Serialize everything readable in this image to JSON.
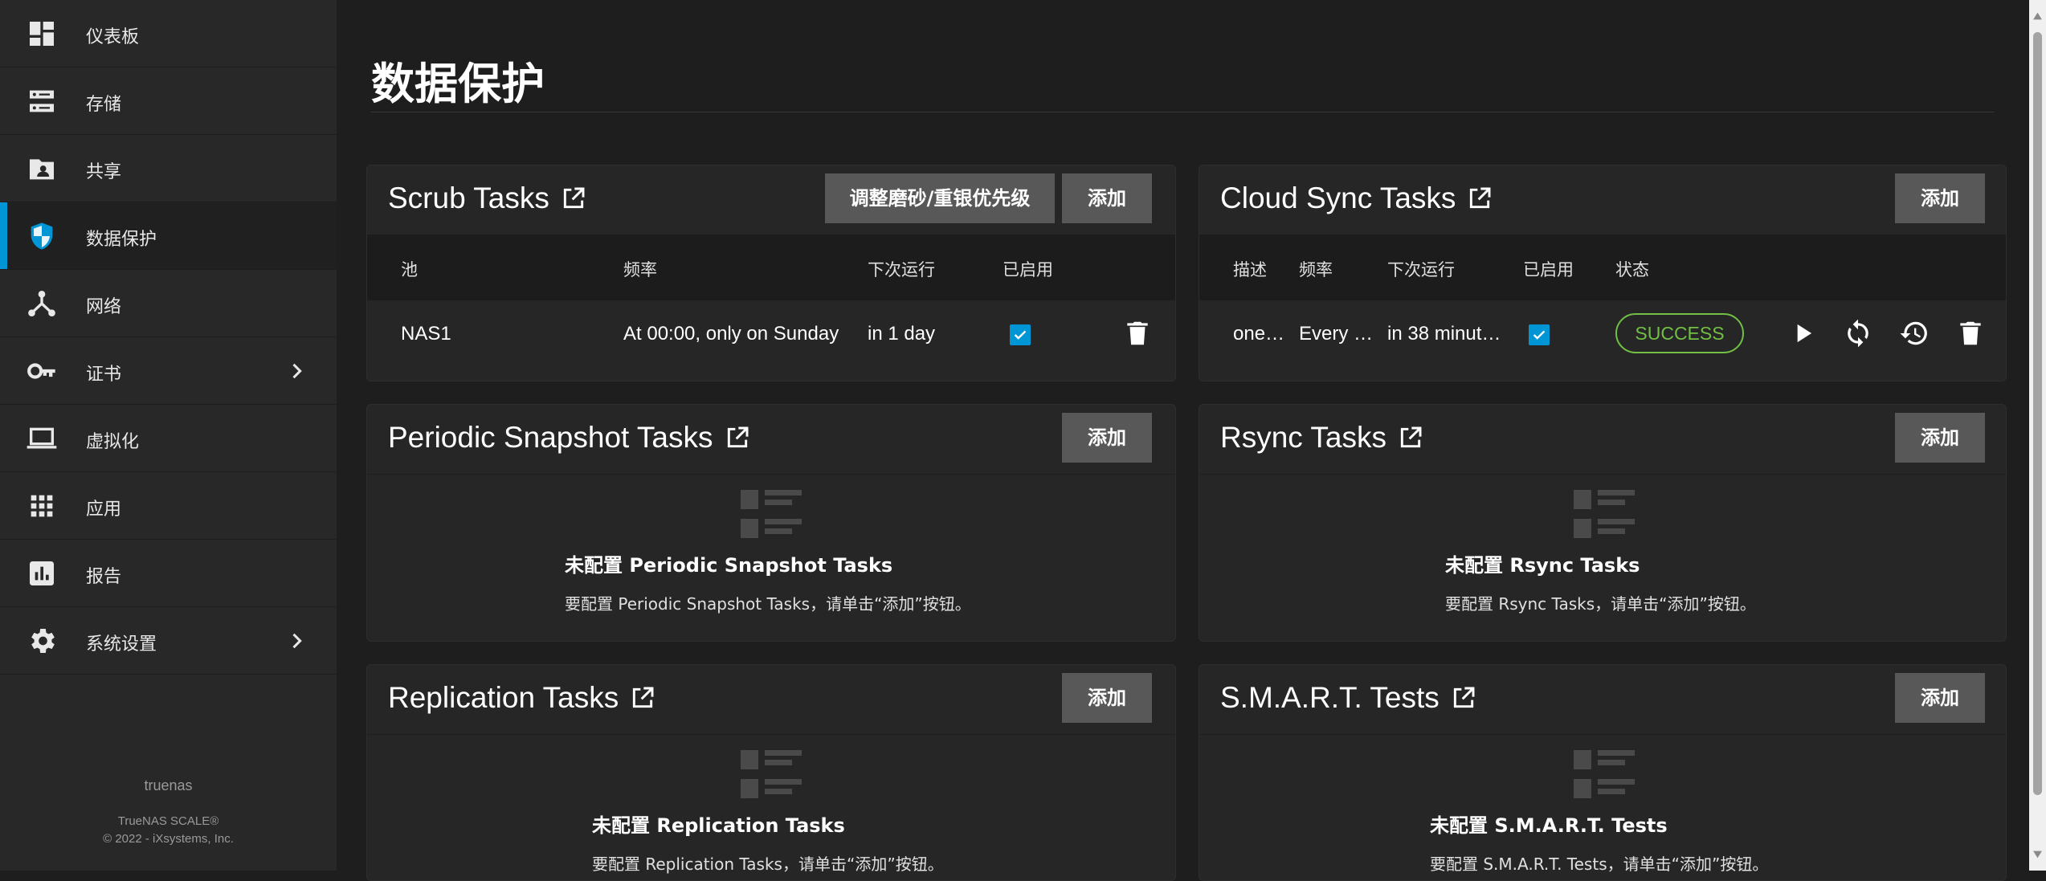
{
  "sidebar": {
    "items": [
      {
        "label": "仪表板",
        "icon": "dashboard-icon",
        "active": false,
        "chevron": false
      },
      {
        "label": "存储",
        "icon": "storage-icon",
        "active": false,
        "chevron": false
      },
      {
        "label": "共享",
        "icon": "folder-share-icon",
        "active": false,
        "chevron": false
      },
      {
        "label": "数据保护",
        "icon": "security-shield-icon",
        "active": true,
        "chevron": false
      },
      {
        "label": "网络",
        "icon": "network-icon",
        "active": false,
        "chevron": false
      },
      {
        "label": "证书",
        "icon": "key-icon",
        "active": false,
        "chevron": true
      },
      {
        "label": "虚拟化",
        "icon": "laptop-icon",
        "active": false,
        "chevron": false
      },
      {
        "label": "应用",
        "icon": "apps-grid-icon",
        "active": false,
        "chevron": false
      },
      {
        "label": "报告",
        "icon": "chart-icon",
        "active": false,
        "chevron": false
      },
      {
        "label": "系统设置",
        "icon": "gear-icon",
        "active": false,
        "chevron": true
      }
    ],
    "hostname": "truenas",
    "version": "TrueNAS SCALE®",
    "copyright": "© 2022 - iXsystems, Inc."
  },
  "page": {
    "title": "数据保护"
  },
  "common": {
    "add_label": "添加"
  },
  "scrub": {
    "title": "Scrub Tasks",
    "priority_button": "调整磨砂/重银优先级",
    "columns": [
      "池",
      "频率",
      "下次运行",
      "已启用"
    ],
    "row": {
      "pool": "NAS1",
      "frequency": "At 00:00, only on Sunday",
      "next_run": "in 1 day",
      "enabled": true
    }
  },
  "cloud": {
    "title": "Cloud Sync Tasks",
    "columns": [
      "描述",
      "频率",
      "下次运行",
      "已启用",
      "状态"
    ],
    "row": {
      "description": "one…",
      "frequency": "Every …",
      "next_run": "in 38 minut…",
      "enabled": true,
      "status": "SUCCESS"
    }
  },
  "snapshot": {
    "title": "Periodic Snapshot Tasks",
    "empty_title": "未配置 Periodic Snapshot Tasks",
    "empty_message": "要配置 Periodic Snapshot Tasks，请单击“添加”按钮。"
  },
  "rsync": {
    "title": "Rsync Tasks",
    "empty_title": "未配置 Rsync Tasks",
    "empty_message": "要配置 Rsync Tasks，请单击“添加”按钮。"
  },
  "replication": {
    "title": "Replication Tasks",
    "empty_title": "未配置 Replication Tasks",
    "empty_message": "要配置 Replication Tasks，请单击“添加”按钮。"
  },
  "smart": {
    "title": "S.M.A.R.T. Tests",
    "empty_title": "未配置 S.M.A.R.T. Tests",
    "empty_message": "要配置 S.M.A.R.T. Tests，请单击“添加”按钮。"
  },
  "colors": {
    "accent": "#0095d5",
    "success": "#71bf44",
    "button": "#585858"
  }
}
